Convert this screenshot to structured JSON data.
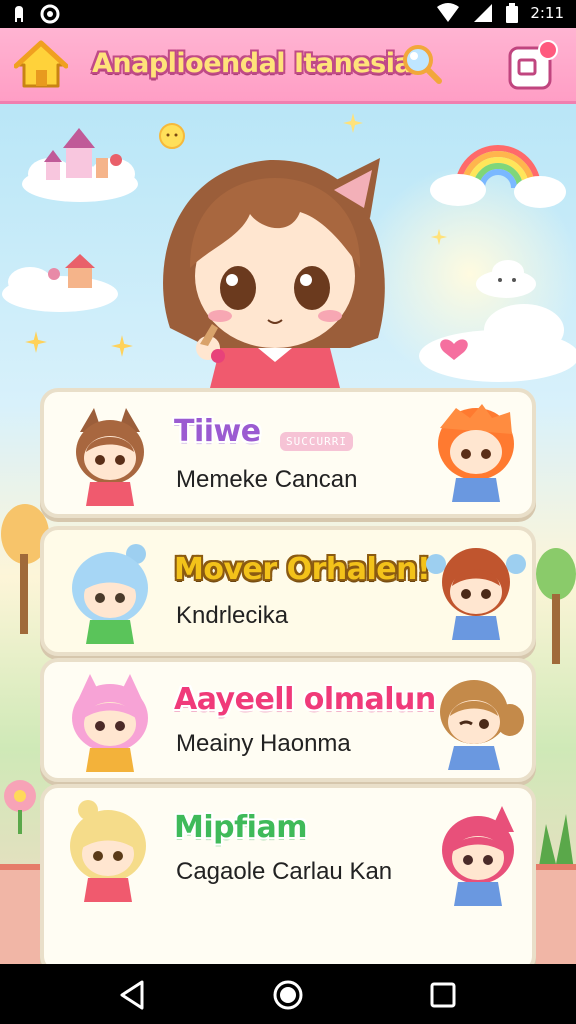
{
  "status_bar": {
    "time": "2:11"
  },
  "app_bar": {
    "title": "Anaplioendal Itanesia"
  },
  "cards": [
    {
      "title": "Tiiwe",
      "badge": "SUCCURRI",
      "subtitle": "Memeke Cancan",
      "title_color": "#9b5bd1",
      "title_outline": "#ffffff"
    },
    {
      "title": "Mover Orhalen!",
      "subtitle": "Kndrlecika",
      "title_color": "#f3c21a",
      "title_outline": "#8a5a12"
    },
    {
      "title": "Aayeell olmalun",
      "subtitle": "Meainy Haonma",
      "title_color": "#f03a7a",
      "title_outline": "#ffffff"
    },
    {
      "title": "Mipfiam",
      "subtitle": "Cagaole Carlau Kan",
      "title_color": "#3fba5a",
      "title_outline": "#ffffff"
    }
  ],
  "icons": {
    "home": "home-icon",
    "search": "search-icon",
    "profile": "profile-card-icon",
    "nav_back": "back-triangle-icon",
    "nav_home": "home-circle-icon",
    "nav_recents": "recents-square-icon"
  },
  "colors": {
    "app_bar": "#ff9ec5",
    "title_fill": "#ffe37a",
    "title_stroke": "#c04a87"
  }
}
